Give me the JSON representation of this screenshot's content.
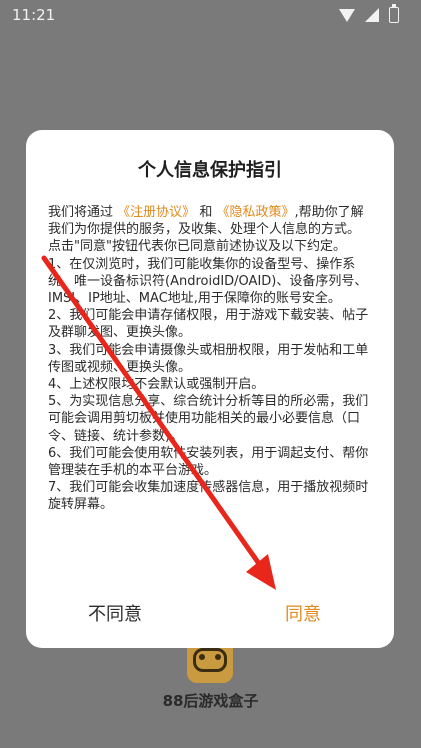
{
  "status_bar": {
    "time": "11:21",
    "icons": [
      "wifi-icon",
      "signal-icon",
      "battery-icon"
    ]
  },
  "background_app": {
    "name": "88后游戏盒子",
    "logo": "gamepad-icon"
  },
  "dialog": {
    "title": "个人信息保护指引",
    "intro_1": "我们将通过",
    "link_register": "《注册协议》",
    "intro_and": "和",
    "link_privacy": "《隐私政策》",
    "intro_2": ",帮助你了解我们为你提供的服务，及收集、处理个人信息的方式。",
    "para_agree": "点击\"同意\"按钮代表你已同意前述协议及以下约定。",
    "item_1": "1、在仅浏览时，我们可能收集你的设备型号、操作系统、唯一设备标识符(AndroidID/OAID)、设备序列号、IMSI、IP地址、MAC地址,用于保障你的账号安全。",
    "item_2": "2、我们可能会申请存储权限，用于游戏下载安装、帖子及群聊发图、更换头像。",
    "item_3": "3、我们可能会申请摄像头或相册权限，用于发帖和工单传图或视频、更换头像。",
    "item_4": "4、上述权限均不会默认或强制开启。",
    "item_5": "5、为实现信息分享、综合统计分析等目的所必需，我们可能会调用剪切板并使用功能相关的最小必要信息（口令、链接、统计参数)。",
    "item_6": "6、我们可能会使用软件安装列表，用于调起支付、帮你管理装在手机的本平台游戏。",
    "item_7": "7、我们可能会收集加速度传感器信息，用于播放视频时旋转屏幕。",
    "button_disagree": "不同意",
    "button_agree": "同意"
  },
  "colors": {
    "accent": "#e08a1e",
    "annotation_arrow": "#e8261c",
    "scrim": "#7a7a7a"
  }
}
